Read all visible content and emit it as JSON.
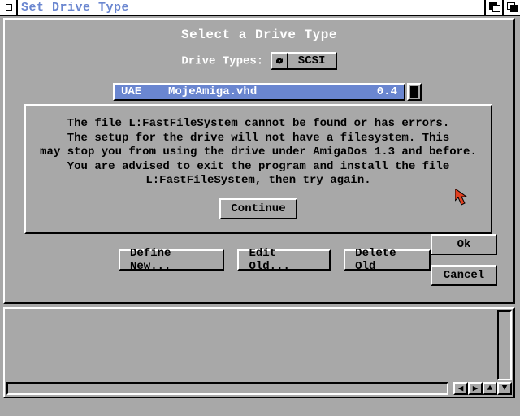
{
  "window": {
    "title": "Set Drive Type"
  },
  "main": {
    "heading": "Select a Drive Type",
    "drive_types_label": "Drive Types:",
    "drive_types_value": "SCSI",
    "list": [
      {
        "col1": "UAE",
        "col2": "MojeAmiga.vhd",
        "col3": "0.4"
      }
    ],
    "buttons": {
      "define_new": "Define New...",
      "edit_old": "Edit Old...",
      "delete_old": "Delete Old",
      "ok": "Ok",
      "cancel": "Cancel"
    }
  },
  "dialog": {
    "message": "The file L:FastFileSystem cannot be found or has errors.\nThe setup for the drive will not have a filesystem.  This\nmay stop you from using the drive under AmigaDos 1.3 and before.\nYou are advised to exit the program and install the file\nL:FastFileSystem, then try again.",
    "continue": "Continue"
  },
  "icons": {
    "cycle": "cycle-icon",
    "scroll_left": "◀",
    "scroll_right": "▶",
    "scroll_up": "▲",
    "scroll_down": "▼"
  },
  "colors": {
    "bg": "#a8a8a8",
    "highlight": "#6a86d0",
    "cursor": "#e04020"
  }
}
